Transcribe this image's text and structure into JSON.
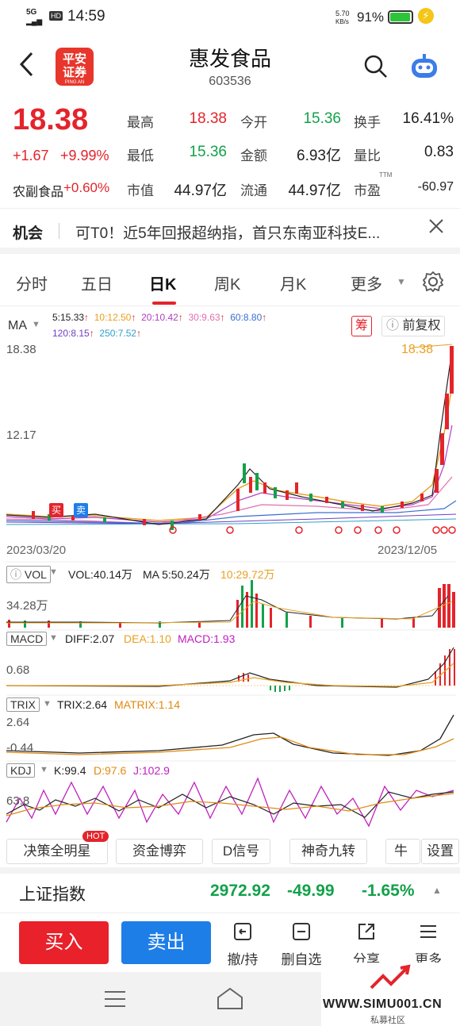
{
  "status": {
    "network": "5G",
    "hd": "HD",
    "time": "14:59",
    "speed": "5.70",
    "speed_unit": "KB/s",
    "battery": "91%"
  },
  "header": {
    "logo_text_1": "平安",
    "logo_text_2": "证券",
    "logo_sub": "PING AN",
    "stock_name": "惠发食品",
    "stock_code": "603536"
  },
  "quote": {
    "price": "18.38",
    "change": "+1.67",
    "change_pct": "+9.99%",
    "sector": "农副食品",
    "sector_pct": "+0.60%",
    "rows": [
      [
        {
          "label": "最高",
          "value": "18.38",
          "color": "red"
        },
        {
          "label": "今开",
          "value": "15.36",
          "color": "green"
        },
        {
          "label": "换手",
          "value": "16.41%",
          "color": "dark"
        }
      ],
      [
        {
          "label": "最低",
          "value": "15.36",
          "color": "green"
        },
        {
          "label": "金额",
          "value": "6.93亿",
          "color": "dark"
        },
        {
          "label": "量比",
          "value": "0.83",
          "color": "dark"
        }
      ],
      [
        {
          "label": "市值",
          "value": "44.97亿",
          "color": "dark"
        },
        {
          "label": "流通",
          "value": "44.97亿",
          "color": "dark"
        },
        {
          "label": "市盈",
          "value": "-60.97",
          "color": "dark"
        }
      ]
    ],
    "pe_sup": "TTM"
  },
  "news": {
    "tag": "机会",
    "text": "可T0！近5年回报超纳指，首只东南亚科技E..."
  },
  "tabs": [
    "分时",
    "五日",
    "日K",
    "周K",
    "月K",
    "更多"
  ],
  "active_tab": 2,
  "chart": {
    "ma_label": "MA",
    "ma_values": [
      {
        "text": "5:15.33",
        "color": "#222222"
      },
      {
        "text": "10:12.50",
        "color": "#e8a020"
      },
      {
        "text": "20:10.42",
        "color": "#b040c0"
      },
      {
        "text": "30:9.63",
        "color": "#e070b0"
      },
      {
        "text": "60:8.80",
        "color": "#3a6fd0"
      },
      {
        "text": "120:8.15",
        "color": "#7040c0"
      },
      {
        "text": "250:7.52",
        "color": "#30a0c8"
      }
    ],
    "chip_label": "筹",
    "adjust_label": "前复权",
    "price_top": "18.38",
    "price_mid": "12.17",
    "price_last": "18.38",
    "date_start": "2023/03/20",
    "date_end": "2023/12/05",
    "buy_tag": "买",
    "sell_tag": "卖",
    "vol": {
      "name": "VOL",
      "text1": "VOL:40.14万",
      "text2": "MA 5:50.24万",
      "text3": "10:29.72万",
      "axis": "34.28万"
    },
    "macd": {
      "name": "MACD",
      "diff": "DIFF:2.07",
      "dea": "DEA:1.10",
      "macd": "MACD:1.93",
      "axis": "0.68"
    },
    "trix": {
      "name": "TRIX",
      "trix": "TRIX:2.64",
      "matrix": "MATRIX:1.14",
      "axis_top": "2.64",
      "axis_bottom": "-0.44"
    },
    "kdj": {
      "name": "KDJ",
      "k": "K:99.4",
      "d": "D:97.6",
      "j": "J:102.9",
      "axis": "63.8"
    }
  },
  "tools": [
    "决策全明星",
    "资金博弈",
    "D信号",
    "神奇九转",
    "牛熊",
    "设置"
  ],
  "tool_badge": "HOT",
  "index": {
    "name": "上证指数",
    "value": "2972.92",
    "change": "-49.99",
    "pct": "-1.65%"
  },
  "trade": {
    "buy": "买入",
    "sell": "卖出",
    "actions": [
      {
        "label": "撤/持",
        "icon": "cancel-hold-icon"
      },
      {
        "label": "删自选",
        "icon": "remove-watch-icon"
      },
      {
        "label": "分享",
        "icon": "share-icon"
      },
      {
        "label": "更多",
        "icon": "more-icon"
      }
    ]
  },
  "watermark": {
    "site": "WWW.SIMU001.CN",
    "sub": "私募社区"
  },
  "colors": {
    "red": "#e3242b",
    "green": "#13a14a",
    "sell_blue": "#1e7ee8",
    "macd_purple": "#c020c0",
    "trix_orange": "#e08a10"
  }
}
